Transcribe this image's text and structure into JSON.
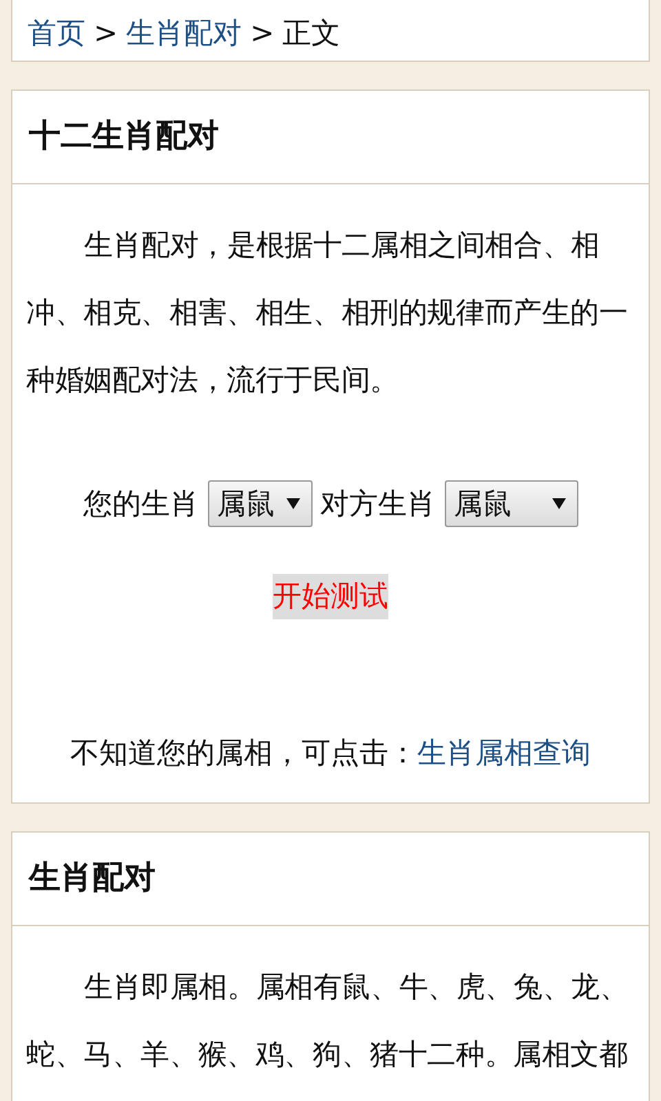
{
  "breadcrumb": [
    {
      "label": "首页",
      "kind": "link"
    },
    {
      "label": "生肖配对",
      "kind": "link"
    },
    {
      "label": "正文",
      "kind": "current"
    }
  ],
  "breadcrumb_separator": ">",
  "sections": [
    {
      "title": "十二生肖配对",
      "paragraphs": [
        "生肖配对，是根据十二属相之间相合、相冲、相克、相害、相生、相刑的规律而产生的一种婚姻配对法，流行于民间。"
      ],
      "form": {
        "fields": [
          {
            "label": "您的生肖",
            "value": "属鼠"
          },
          {
            "label": "对方生肖",
            "value": "属鼠"
          }
        ],
        "button": "开始测试"
      },
      "hint": {
        "text": "不知道您的属相，可点击：",
        "link": "生肖属相查询"
      }
    },
    {
      "title": "生肖配对",
      "paragraphs": [
        "生肖即属相。属相有鼠、牛、虎、兔、龙、蛇、马、羊、猴、鸡、狗、猪十二种。属相文都"
      ]
    }
  ]
}
